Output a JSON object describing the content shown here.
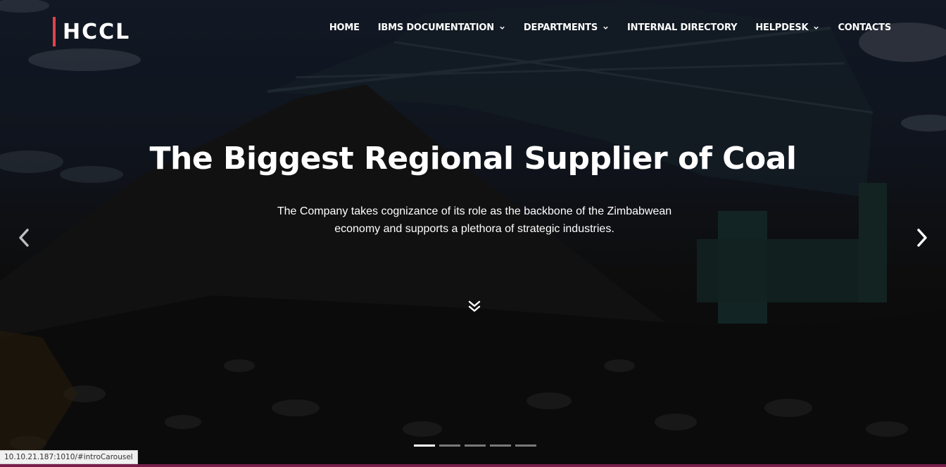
{
  "logo": {
    "text": "HCCL"
  },
  "nav": {
    "items": [
      {
        "label": "HOME",
        "dropdown": false
      },
      {
        "label": "IBMS DOCUMENTATION",
        "dropdown": true
      },
      {
        "label": "DEPARTMENTS",
        "dropdown": true
      },
      {
        "label": "INTERNAL DIRECTORY",
        "dropdown": false
      },
      {
        "label": "HELPDESK",
        "dropdown": true
      },
      {
        "label": "CONTACTS",
        "dropdown": false
      }
    ]
  },
  "hero": {
    "title": "The Biggest Regional Supplier of Coal",
    "subtitle": "The Company takes cognizance of its role as the backbone of the Zimbabwean economy and supports a plethora of strategic industries."
  },
  "carousel": {
    "slide_count": 5,
    "active_index": 0,
    "prev_icon": "chevron-left-icon",
    "next_icon": "chevron-right-icon",
    "scroll_icon": "double-chevron-down-icon"
  },
  "status_bar": {
    "url": "10.10.21.187:1010/#introCarousel"
  },
  "colors": {
    "accent": "#e2434b",
    "text": "#ffffff",
    "bottom_line": "#7a1d4a"
  }
}
